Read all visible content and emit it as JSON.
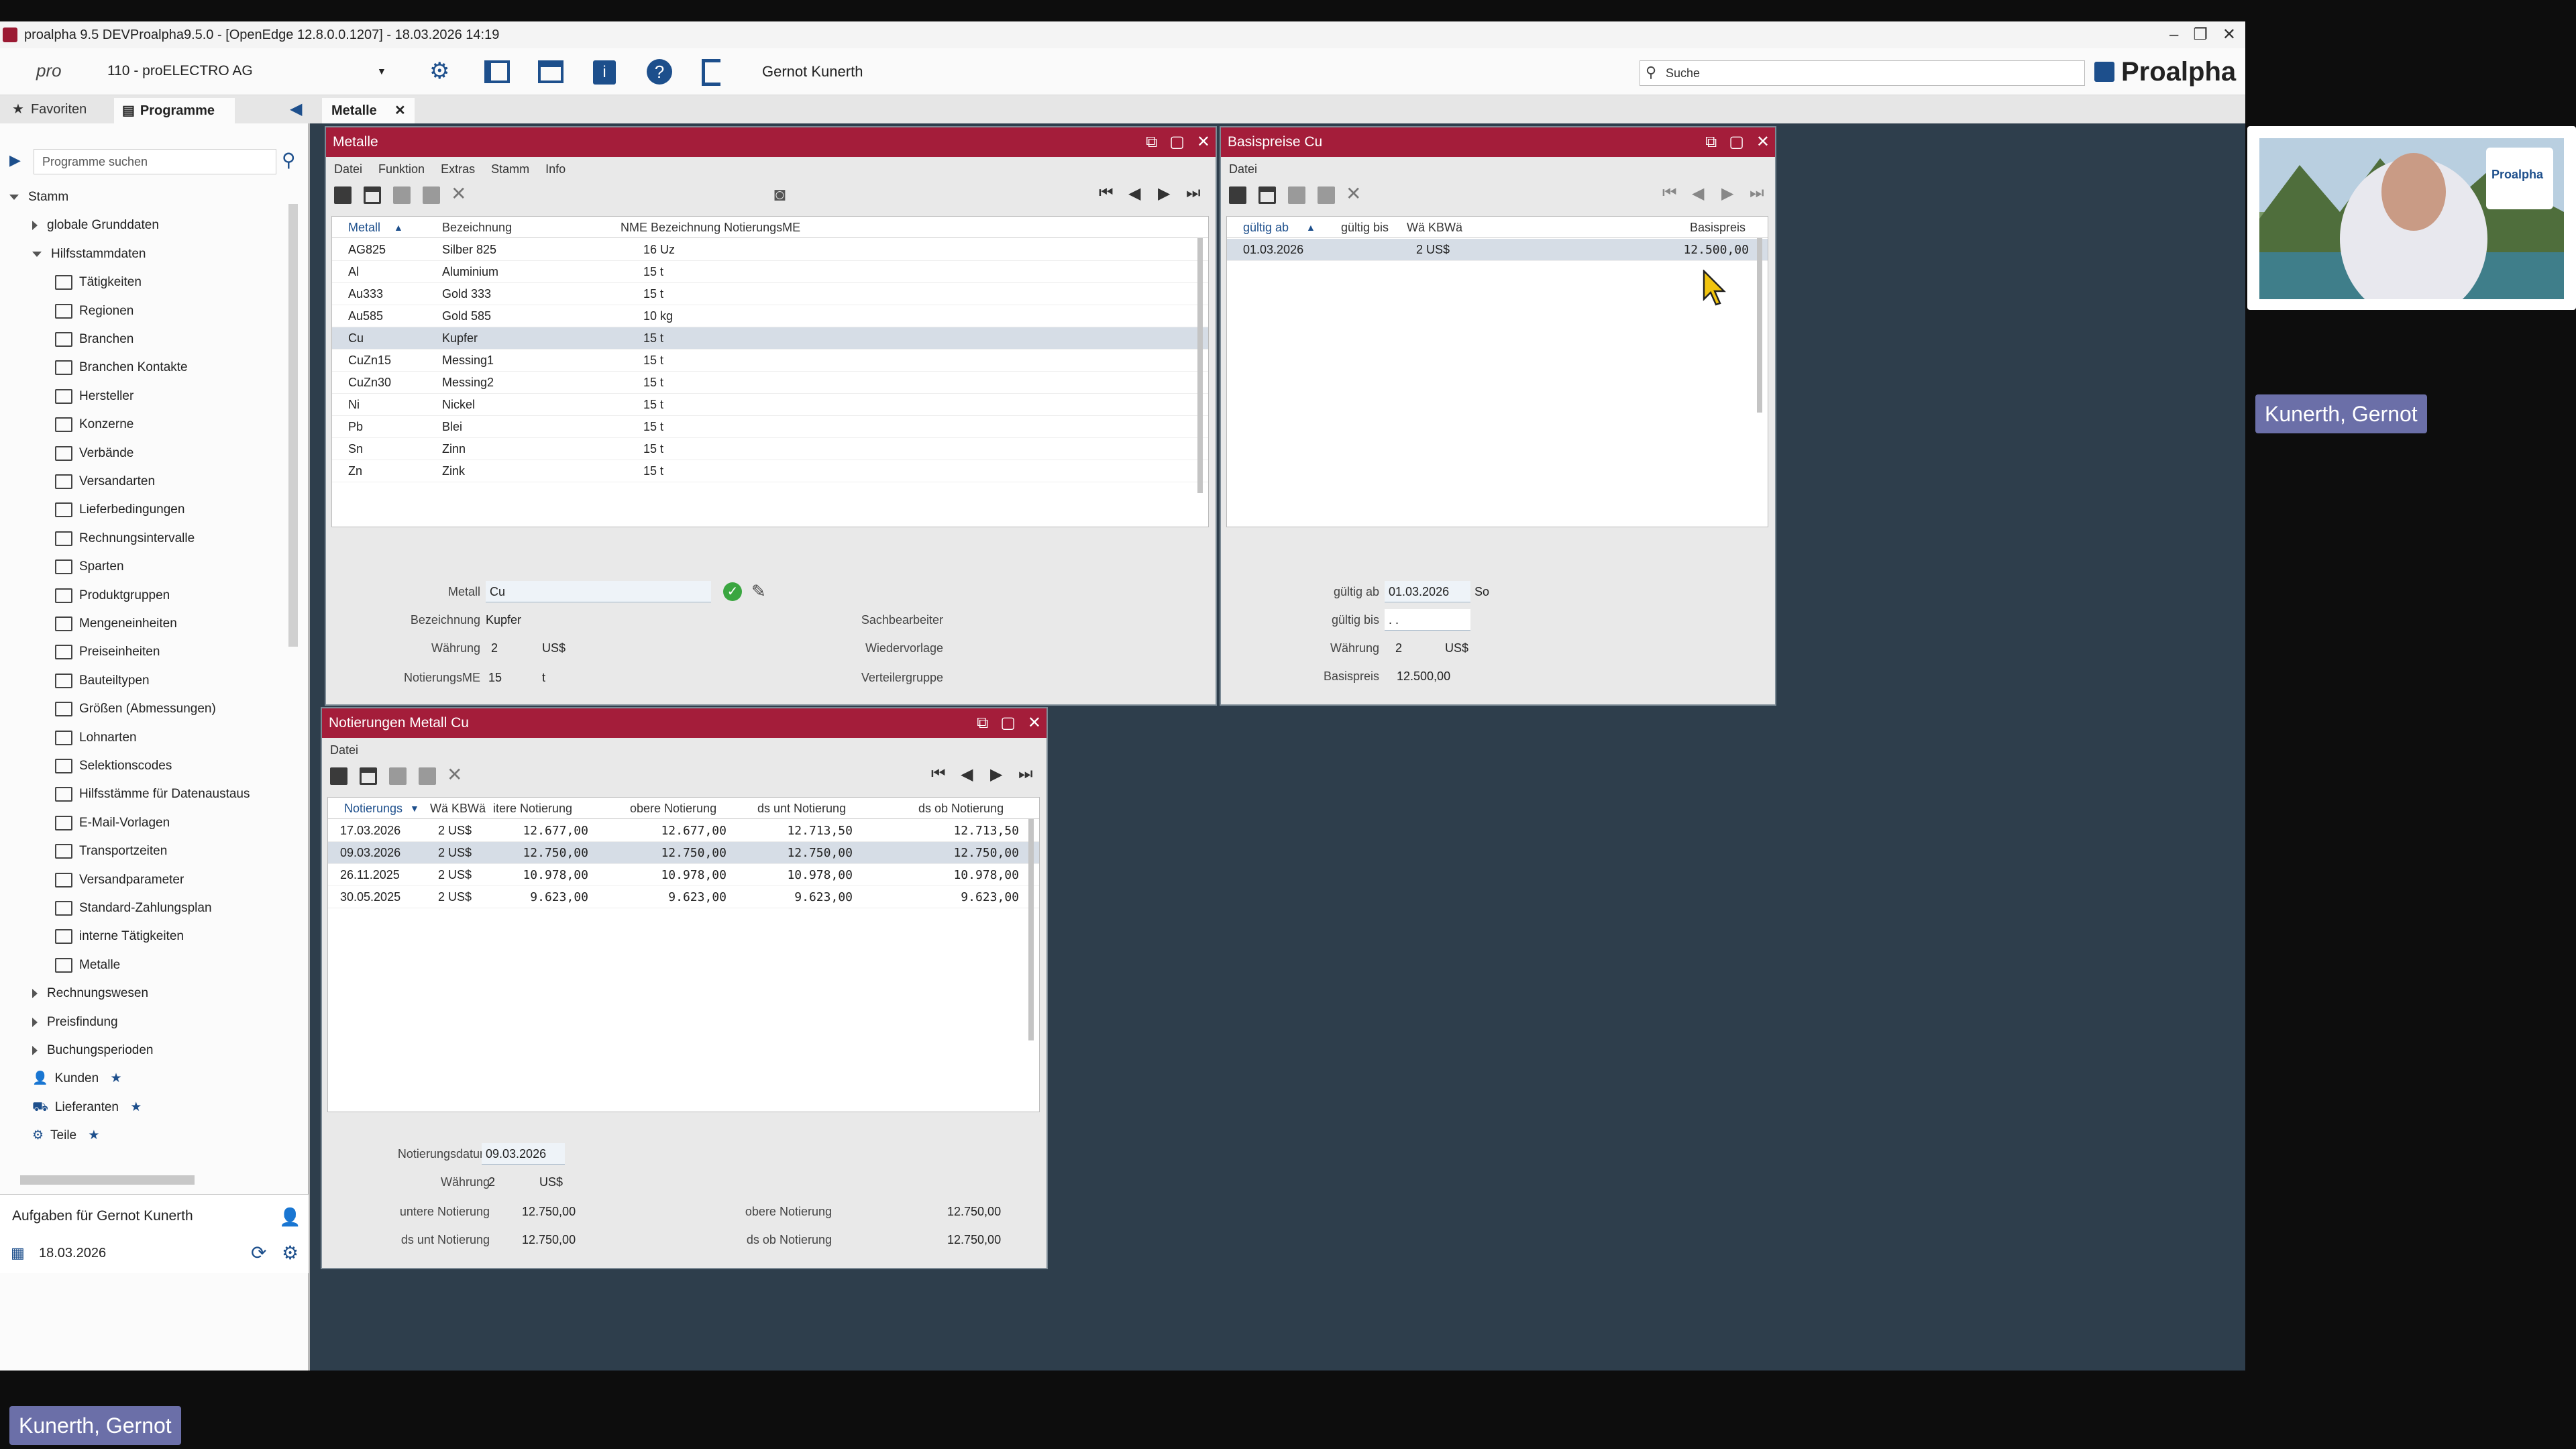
{
  "app": {
    "window_title": "proalpha 9.5 DEVProalpha9.5.0 - [OpenEdge 12.8.0.0.1207] - 18.03.2026 14:19",
    "company": "110 - proELECTRO AG",
    "user": "Gernot Kunerth",
    "search_placeholder": "Suche",
    "brand": "Proalpha",
    "pro_label": "pro"
  },
  "tabs": {
    "favoriten": "Favoriten",
    "programme": "Programme",
    "open_tab": "Metalle"
  },
  "sidebar": {
    "search_placeholder": "Programme suchen",
    "items": [
      {
        "label": "Stamm",
        "level": 0,
        "kind": "open"
      },
      {
        "label": "globale Grunddaten",
        "level": 1,
        "kind": "closed"
      },
      {
        "label": "Hilfsstammdaten",
        "level": 1,
        "kind": "open"
      },
      {
        "label": "Tätigkeiten",
        "level": 2,
        "kind": "leaf"
      },
      {
        "label": "Regionen",
        "level": 2,
        "kind": "leaf"
      },
      {
        "label": "Branchen",
        "level": 2,
        "kind": "leaf"
      },
      {
        "label": "Branchen Kontakte",
        "level": 2,
        "kind": "leaf"
      },
      {
        "label": "Hersteller",
        "level": 2,
        "kind": "leaf"
      },
      {
        "label": "Konzerne",
        "level": 2,
        "kind": "leaf"
      },
      {
        "label": "Verbände",
        "level": 2,
        "kind": "leaf"
      },
      {
        "label": "Versandarten",
        "level": 2,
        "kind": "leaf"
      },
      {
        "label": "Lieferbedingungen",
        "level": 2,
        "kind": "leaf"
      },
      {
        "label": "Rechnungsintervalle",
        "level": 2,
        "kind": "leaf"
      },
      {
        "label": "Sparten",
        "level": 2,
        "kind": "leaf"
      },
      {
        "label": "Produktgruppen",
        "level": 2,
        "kind": "leaf"
      },
      {
        "label": "Mengeneinheiten",
        "level": 2,
        "kind": "leaf"
      },
      {
        "label": "Preiseinheiten",
        "level": 2,
        "kind": "leaf"
      },
      {
        "label": "Bauteiltypen",
        "level": 2,
        "kind": "leaf"
      },
      {
        "label": "Größen (Abmessungen)",
        "level": 2,
        "kind": "leaf"
      },
      {
        "label": "Lohnarten",
        "level": 2,
        "kind": "leaf"
      },
      {
        "label": "Selektionscodes",
        "level": 2,
        "kind": "leaf"
      },
      {
        "label": "Hilfsstämme für Datenaustaus",
        "level": 2,
        "kind": "leaf"
      },
      {
        "label": "E-Mail-Vorlagen",
        "level": 2,
        "kind": "leaf"
      },
      {
        "label": "Transportzeiten",
        "level": 2,
        "kind": "leaf"
      },
      {
        "label": "Versandparameter",
        "level": 2,
        "kind": "leaf"
      },
      {
        "label": "Standard-Zahlungsplan",
        "level": 2,
        "kind": "leaf"
      },
      {
        "label": "interne Tätigkeiten",
        "level": 2,
        "kind": "leaf"
      },
      {
        "label": "Metalle",
        "level": 2,
        "kind": "leaf"
      },
      {
        "label": "Rechnungswesen",
        "level": 1,
        "kind": "closed"
      },
      {
        "label": "Preisfindung",
        "level": 1,
        "kind": "closed"
      },
      {
        "label": "Buchungsperioden",
        "level": 1,
        "kind": "closed"
      },
      {
        "label": "Kunden",
        "level": 1,
        "kind": "person"
      },
      {
        "label": "Lieferanten",
        "level": 1,
        "kind": "truck"
      },
      {
        "label": "Teile",
        "level": 1,
        "kind": "parts"
      }
    ],
    "tasks_title": "Aufgaben für Gernot Kunerth",
    "tasks_date": "18.03.2026"
  },
  "metalle": {
    "title": "Metalle",
    "menu": [
      "Datei",
      "Funktion",
      "Extras",
      "Stamm",
      "Info"
    ],
    "columns": [
      "Metall",
      "Bezeichnung",
      "NME Bezeichnung NotierungsME"
    ],
    "rows": [
      {
        "metall": "AG825",
        "bez": "Silber 825",
        "nme": "16 Uz"
      },
      {
        "metall": "Al",
        "bez": "Aluminium",
        "nme": "15 t"
      },
      {
        "metall": "Au333",
        "bez": "Gold 333",
        "nme": "15 t"
      },
      {
        "metall": "Au585",
        "bez": "Gold 585",
        "nme": "10 kg"
      },
      {
        "metall": "Cu",
        "bez": "Kupfer",
        "nme": "15 t"
      },
      {
        "metall": "CuZn15",
        "bez": "Messing1",
        "nme": "15 t"
      },
      {
        "metall": "CuZn30",
        "bez": "Messing2",
        "nme": "15 t"
      },
      {
        "metall": "Ni",
        "bez": "Nickel",
        "nme": "15 t"
      },
      {
        "metall": "Pb",
        "bez": "Blei",
        "nme": "15 t"
      },
      {
        "metall": "Sn",
        "bez": "Zinn",
        "nme": "15 t"
      },
      {
        "metall": "Zn",
        "bez": "Zink",
        "nme": "15 t"
      }
    ],
    "form": {
      "metall_label": "Metall",
      "metall_value": "Cu",
      "bez_label": "Bezeichnung",
      "bez_value": "Kupfer",
      "waehrung_label": "Währung",
      "waehrung_code": "2",
      "waehrung_value": "US$",
      "nme_label": "NotierungsME",
      "nme_code": "15",
      "nme_value": "t",
      "sachbearbeiter_label": "Sachbearbeiter",
      "wiedervorlage_label": "Wiedervorlage",
      "verteilergruppe_label": "Verteilergruppe"
    }
  },
  "basispreise": {
    "title": "Basispreise Cu",
    "menu": [
      "Datei"
    ],
    "columns": [
      "gültig ab",
      "gültig bis",
      "Wä KBWä",
      "Basispreis"
    ],
    "rows": [
      {
        "ab": "01.03.2026",
        "bis": "",
        "wae": "2 US$",
        "preis": "12.500,00"
      }
    ],
    "form": {
      "ab_label": "gültig ab",
      "ab_value": "01.03.2026",
      "ab_day": "So",
      "bis_label": "gültig bis",
      "bis_value": ". .",
      "waehrung_label": "Währung",
      "waehrung_code": "2",
      "waehrung_value": "US$",
      "preis_label": "Basispreis",
      "preis_value": "12.500,00"
    }
  },
  "notierungen": {
    "title": "Notierungen Metall Cu",
    "menu": [
      "Datei"
    ],
    "columns": [
      "Notierungs",
      "Wä KBWä",
      "itere Notierung",
      "obere Notierung",
      "ds unt Notierung",
      "ds ob Notierung"
    ],
    "rows": [
      {
        "datum": "17.03.2026",
        "wae": "2 US$",
        "unt": "12.677,00",
        "ob": "12.677,00",
        "dsu": "12.713,50",
        "dso": "12.713,50"
      },
      {
        "datum": "09.03.2026",
        "wae": "2 US$",
        "unt": "12.750,00",
        "ob": "12.750,00",
        "dsu": "12.750,00",
        "dso": "12.750,00"
      },
      {
        "datum": "26.11.2025",
        "wae": "2 US$",
        "unt": "10.978,00",
        "ob": "10.978,00",
        "dsu": "10.978,00",
        "dso": "10.978,00"
      },
      {
        "datum": "30.05.2025",
        "wae": "2 US$",
        "unt": "9.623,00",
        "ob": "9.623,00",
        "dsu": "9.623,00",
        "dso": "9.623,00"
      }
    ],
    "form": {
      "datum_label": "Notierungsdatum",
      "datum_value": "09.03.2026",
      "waehrung_label": "Währung",
      "waehrung_code": "2",
      "waehrung_value": "US$",
      "unt_label": "untere Notierung",
      "unt_value": "12.750,00",
      "ob_label": "obere Notierung",
      "ob_value": "12.750,00",
      "dsu_label": "ds unt Notierung",
      "dsu_value": "12.750,00",
      "dso_label": "ds ob Notierung",
      "dso_value": "12.750,00"
    }
  },
  "video": {
    "presenter_name": "Kunerth, Gernot",
    "self_name": "Kunerth, Gernot",
    "shirt_logo": "Proalpha"
  },
  "colors": {
    "window_title": "#a41d3a",
    "desktop": "#2e3e4c",
    "name_badge": "#6b6fa8"
  }
}
